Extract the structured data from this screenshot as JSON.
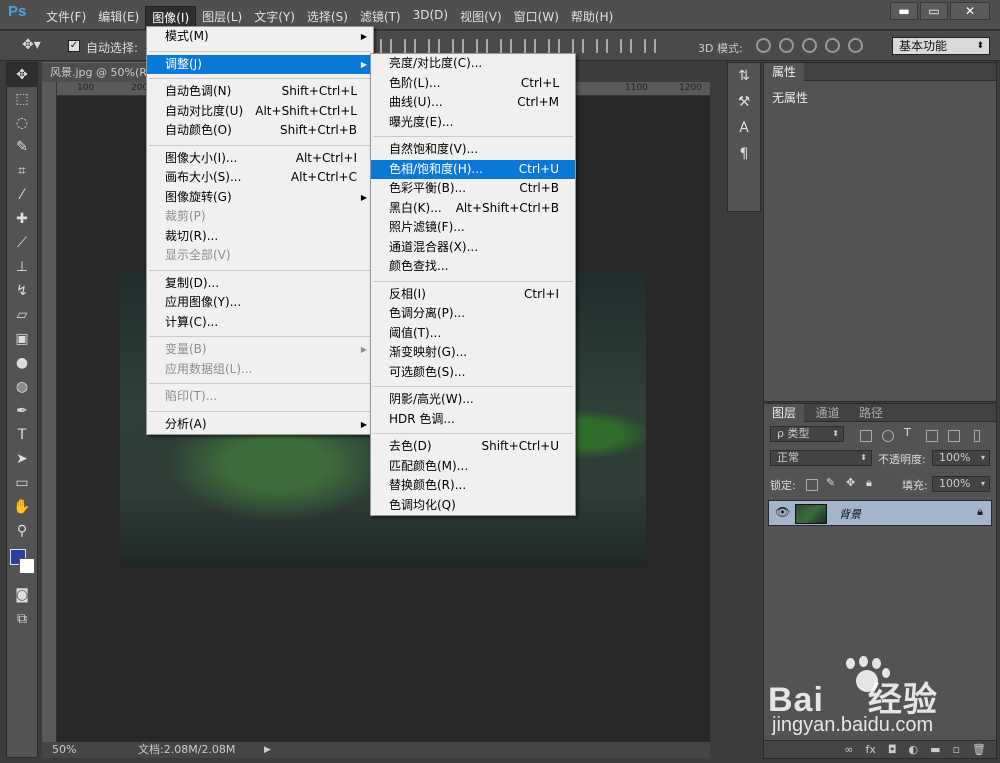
{
  "app": {
    "logo": "Ps"
  },
  "menubar": {
    "items": [
      "文件(F)",
      "编辑(E)",
      "图像(I)",
      "图层(L)",
      "文字(Y)",
      "选择(S)",
      "滤镜(T)",
      "3D(D)",
      "视图(V)",
      "窗口(W)",
      "帮助(H)"
    ],
    "active_index": 2
  },
  "window_controls": {
    "minimize": "▬",
    "restore": "▭",
    "close": "✕"
  },
  "options_bar": {
    "auto_select_label": "自动选择:",
    "auto_select_checked": true,
    "mode_3d_label": "3D 模式:",
    "workspace": "基本功能"
  },
  "document": {
    "tab_title": "风景.jpg @ 50%(R",
    "ruler_labels": [
      "100",
      "200",
      "1100",
      "1200"
    ],
    "zoom": "50%",
    "doc_info": "文档:2.08M/2.08M"
  },
  "toolbar": {
    "tools": [
      "move-tool",
      "marquee-tool",
      "lasso-tool",
      "quick-select-tool",
      "crop-tool",
      "eyedropper-tool",
      "healing-tool",
      "brush-tool",
      "stamp-tool",
      "history-brush-tool",
      "eraser-tool",
      "gradient-tool",
      "blur-tool",
      "dodge-tool",
      "pen-tool",
      "type-tool",
      "path-select-tool",
      "shape-tool",
      "hand-tool",
      "zoom-tool"
    ],
    "foreground_color": "#2b3ea8",
    "background_color": "#ffffff"
  },
  "image_menu": {
    "items": [
      {
        "label": "模式(M)",
        "shortcut": "",
        "submenu": true,
        "disabled": false,
        "highlight": false
      },
      {
        "sep": true
      },
      {
        "label": "调整(J)",
        "shortcut": "",
        "submenu": true,
        "disabled": false,
        "highlight": true
      },
      {
        "sep": true
      },
      {
        "label": "自动色调(N)",
        "shortcut": "Shift+Ctrl+L",
        "submenu": false,
        "disabled": false,
        "highlight": false
      },
      {
        "label": "自动对比度(U)",
        "shortcut": "Alt+Shift+Ctrl+L",
        "submenu": false,
        "disabled": false,
        "highlight": false
      },
      {
        "label": "自动颜色(O)",
        "shortcut": "Shift+Ctrl+B",
        "submenu": false,
        "disabled": false,
        "highlight": false
      },
      {
        "sep": true
      },
      {
        "label": "图像大小(I)...",
        "shortcut": "Alt+Ctrl+I",
        "submenu": false,
        "disabled": false,
        "highlight": false
      },
      {
        "label": "画布大小(S)...",
        "shortcut": "Alt+Ctrl+C",
        "submenu": false,
        "disabled": false,
        "highlight": false
      },
      {
        "label": "图像旋转(G)",
        "shortcut": "",
        "submenu": true,
        "disabled": false,
        "highlight": false
      },
      {
        "label": "裁剪(P)",
        "shortcut": "",
        "submenu": false,
        "disabled": true,
        "highlight": false
      },
      {
        "label": "裁切(R)...",
        "shortcut": "",
        "submenu": false,
        "disabled": false,
        "highlight": false
      },
      {
        "label": "显示全部(V)",
        "shortcut": "",
        "submenu": false,
        "disabled": true,
        "highlight": false
      },
      {
        "sep": true
      },
      {
        "label": "复制(D)...",
        "shortcut": "",
        "submenu": false,
        "disabled": false,
        "highlight": false
      },
      {
        "label": "应用图像(Y)...",
        "shortcut": "",
        "submenu": false,
        "disabled": false,
        "highlight": false
      },
      {
        "label": "计算(C)...",
        "shortcut": "",
        "submenu": false,
        "disabled": false,
        "highlight": false
      },
      {
        "sep": true
      },
      {
        "label": "变量(B)",
        "shortcut": "",
        "submenu": true,
        "disabled": true,
        "highlight": false
      },
      {
        "label": "应用数据组(L)...",
        "shortcut": "",
        "submenu": false,
        "disabled": true,
        "highlight": false
      },
      {
        "sep": true
      },
      {
        "label": "陷印(T)...",
        "shortcut": "",
        "submenu": false,
        "disabled": true,
        "highlight": false
      },
      {
        "sep": true
      },
      {
        "label": "分析(A)",
        "shortcut": "",
        "submenu": true,
        "disabled": false,
        "highlight": false
      }
    ]
  },
  "adjust_menu": {
    "items": [
      {
        "label": "亮度/对比度(C)...",
        "shortcut": "",
        "highlight": false
      },
      {
        "label": "色阶(L)...",
        "shortcut": "Ctrl+L",
        "highlight": false
      },
      {
        "label": "曲线(U)...",
        "shortcut": "Ctrl+M",
        "highlight": false
      },
      {
        "label": "曝光度(E)...",
        "shortcut": "",
        "highlight": false
      },
      {
        "sep": true
      },
      {
        "label": "自然饱和度(V)...",
        "shortcut": "",
        "highlight": false
      },
      {
        "label": "色相/饱和度(H)...",
        "shortcut": "Ctrl+U",
        "highlight": true
      },
      {
        "label": "色彩平衡(B)...",
        "shortcut": "Ctrl+B",
        "highlight": false
      },
      {
        "label": "黑白(K)...",
        "shortcut": "Alt+Shift+Ctrl+B",
        "highlight": false
      },
      {
        "label": "照片滤镜(F)...",
        "shortcut": "",
        "highlight": false
      },
      {
        "label": "通道混合器(X)...",
        "shortcut": "",
        "highlight": false
      },
      {
        "label": "颜色查找...",
        "shortcut": "",
        "highlight": false
      },
      {
        "sep": true
      },
      {
        "label": "反相(I)",
        "shortcut": "Ctrl+I",
        "highlight": false
      },
      {
        "label": "色调分离(P)...",
        "shortcut": "",
        "highlight": false
      },
      {
        "label": "阈值(T)...",
        "shortcut": "",
        "highlight": false
      },
      {
        "label": "渐变映射(G)...",
        "shortcut": "",
        "highlight": false
      },
      {
        "label": "可选颜色(S)...",
        "shortcut": "",
        "highlight": false
      },
      {
        "sep": true
      },
      {
        "label": "阴影/高光(W)...",
        "shortcut": "",
        "highlight": false
      },
      {
        "label": "HDR 色调...",
        "shortcut": "",
        "highlight": false
      },
      {
        "sep": true
      },
      {
        "label": "去色(D)",
        "shortcut": "Shift+Ctrl+U",
        "highlight": false
      },
      {
        "label": "匹配颜色(M)...",
        "shortcut": "",
        "highlight": false
      },
      {
        "label": "替换颜色(R)...",
        "shortcut": "",
        "highlight": false
      },
      {
        "label": "色调均化(Q)",
        "shortcut": "",
        "highlight": false
      }
    ]
  },
  "properties_panel": {
    "tab": "属性",
    "body": "无属性"
  },
  "layers_panel": {
    "tabs": [
      "图层",
      "通道",
      "路径"
    ],
    "filter_kind": "ρ 类型",
    "blend_mode": "正常",
    "opacity_label": "不透明度:",
    "opacity_value": "100%",
    "lock_label": "锁定:",
    "fill_label": "填充:",
    "fill_value": "100%",
    "layer_name": "背景"
  },
  "watermark": {
    "brand": "Bai",
    "brand_suffix": "经验",
    "url": "jingyan.baidu.com"
  },
  "colors": {
    "menu_highlight": "#0a78d7",
    "layer_selected": "#a4b4cb",
    "ps_blue": "#4aa3df"
  }
}
